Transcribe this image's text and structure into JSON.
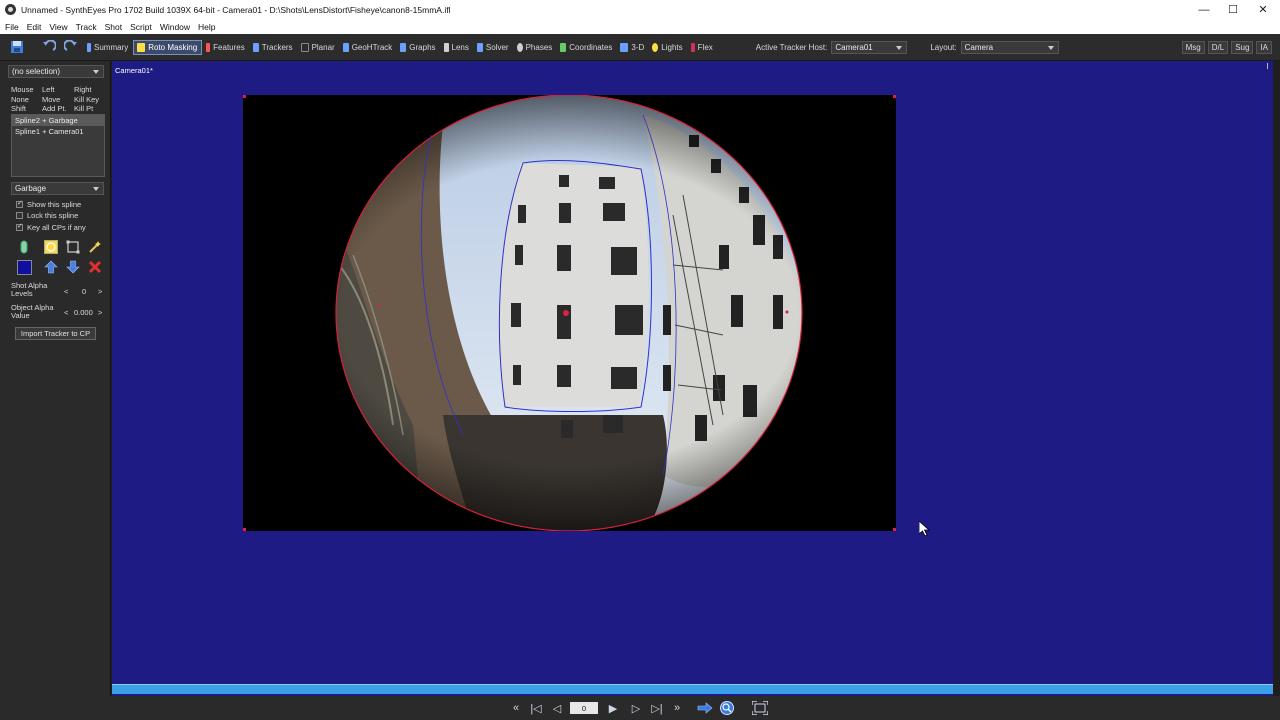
{
  "window": {
    "title": "Unnamed - SynthEyes Pro 1702 Build 1039X 64-bit - Camera01 - D:\\Shots\\LensDistort\\Fisheye\\canon8-15mmA.ifl",
    "minimize": "—",
    "maximize": "☐",
    "close": "✕"
  },
  "menu": [
    "File",
    "Edit",
    "View",
    "Track",
    "Shot",
    "Script",
    "Window",
    "Help"
  ],
  "toolbar": {
    "tabs": [
      {
        "label": "Summary",
        "color": "#6aa0ff"
      },
      {
        "label": "Roto Masking",
        "color": "#ffdd44",
        "active": true
      },
      {
        "label": "Features",
        "color": "#ff5555"
      },
      {
        "label": "Trackers",
        "color": "#6aa0ff"
      },
      {
        "label": "Planar",
        "color": "#888888"
      },
      {
        "label": "GeoHTrack",
        "color": "#6aa0ff"
      },
      {
        "label": "Graphs",
        "color": "#6aa0ff"
      },
      {
        "label": "Lens",
        "color": "#d0d0d0"
      },
      {
        "label": "Solver",
        "color": "#6aa0ff"
      },
      {
        "label": "Phases",
        "color": "#d0d0d0"
      },
      {
        "label": "Coordinates",
        "color": "#66cc66"
      },
      {
        "label": "3-D",
        "color": "#6aa0ff"
      },
      {
        "label": "Lights",
        "color": "#ffdd44"
      },
      {
        "label": "Flex",
        "color": "#cc3355"
      }
    ],
    "active_tracker_host_label": "Active Tracker Host:",
    "active_tracker_host_value": "Camera01",
    "layout_label": "Layout:",
    "layout_value": "Camera",
    "right_buttons": [
      "Msg",
      "D/L",
      "Sug",
      "IA"
    ]
  },
  "left_panel": {
    "selection": "(no selection)",
    "mouse_table": {
      "col1": [
        "Mouse",
        "None",
        "Shift"
      ],
      "col2": [
        "Left",
        "Move",
        "Add Pt."
      ],
      "col3": [
        "Right",
        "Kill Key",
        "Kill Pt"
      ]
    },
    "splines": [
      "Spline2 + Garbage",
      "Spline1 + Camera01"
    ],
    "target": "Garbage",
    "checkboxes": [
      {
        "label": "Show this spline",
        "checked": true
      },
      {
        "label": "Lock this spline",
        "checked": false
      },
      {
        "label": "Key all CPs if any",
        "checked": true
      }
    ],
    "shot_alpha_label": "Shot Alpha Levels",
    "shot_alpha_value": "0",
    "object_alpha_label": "Object Alpha Value",
    "object_alpha_value": "0.000",
    "import_button": "Import Tracker to CP",
    "lt": "<",
    "gt": ">"
  },
  "viewport": {
    "camera_label": "Camera01*",
    "background": "#1f1b85"
  },
  "playback": {
    "frame": "0"
  }
}
